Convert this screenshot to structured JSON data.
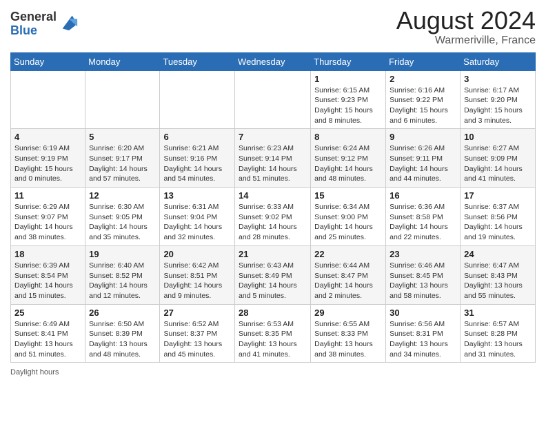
{
  "header": {
    "logo_general": "General",
    "logo_blue": "Blue",
    "month_title": "August 2024",
    "location": "Warmeriville, France"
  },
  "days_of_week": [
    "Sunday",
    "Monday",
    "Tuesday",
    "Wednesday",
    "Thursday",
    "Friday",
    "Saturday"
  ],
  "weeks": [
    [
      {
        "day": "",
        "info": ""
      },
      {
        "day": "",
        "info": ""
      },
      {
        "day": "",
        "info": ""
      },
      {
        "day": "",
        "info": ""
      },
      {
        "day": "1",
        "info": "Sunrise: 6:15 AM\nSunset: 9:23 PM\nDaylight: 15 hours\nand 8 minutes."
      },
      {
        "day": "2",
        "info": "Sunrise: 6:16 AM\nSunset: 9:22 PM\nDaylight: 15 hours\nand 6 minutes."
      },
      {
        "day": "3",
        "info": "Sunrise: 6:17 AM\nSunset: 9:20 PM\nDaylight: 15 hours\nand 3 minutes."
      }
    ],
    [
      {
        "day": "4",
        "info": "Sunrise: 6:19 AM\nSunset: 9:19 PM\nDaylight: 15 hours\nand 0 minutes."
      },
      {
        "day": "5",
        "info": "Sunrise: 6:20 AM\nSunset: 9:17 PM\nDaylight: 14 hours\nand 57 minutes."
      },
      {
        "day": "6",
        "info": "Sunrise: 6:21 AM\nSunset: 9:16 PM\nDaylight: 14 hours\nand 54 minutes."
      },
      {
        "day": "7",
        "info": "Sunrise: 6:23 AM\nSunset: 9:14 PM\nDaylight: 14 hours\nand 51 minutes."
      },
      {
        "day": "8",
        "info": "Sunrise: 6:24 AM\nSunset: 9:12 PM\nDaylight: 14 hours\nand 48 minutes."
      },
      {
        "day": "9",
        "info": "Sunrise: 6:26 AM\nSunset: 9:11 PM\nDaylight: 14 hours\nand 44 minutes."
      },
      {
        "day": "10",
        "info": "Sunrise: 6:27 AM\nSunset: 9:09 PM\nDaylight: 14 hours\nand 41 minutes."
      }
    ],
    [
      {
        "day": "11",
        "info": "Sunrise: 6:29 AM\nSunset: 9:07 PM\nDaylight: 14 hours\nand 38 minutes."
      },
      {
        "day": "12",
        "info": "Sunrise: 6:30 AM\nSunset: 9:05 PM\nDaylight: 14 hours\nand 35 minutes."
      },
      {
        "day": "13",
        "info": "Sunrise: 6:31 AM\nSunset: 9:04 PM\nDaylight: 14 hours\nand 32 minutes."
      },
      {
        "day": "14",
        "info": "Sunrise: 6:33 AM\nSunset: 9:02 PM\nDaylight: 14 hours\nand 28 minutes."
      },
      {
        "day": "15",
        "info": "Sunrise: 6:34 AM\nSunset: 9:00 PM\nDaylight: 14 hours\nand 25 minutes."
      },
      {
        "day": "16",
        "info": "Sunrise: 6:36 AM\nSunset: 8:58 PM\nDaylight: 14 hours\nand 22 minutes."
      },
      {
        "day": "17",
        "info": "Sunrise: 6:37 AM\nSunset: 8:56 PM\nDaylight: 14 hours\nand 19 minutes."
      }
    ],
    [
      {
        "day": "18",
        "info": "Sunrise: 6:39 AM\nSunset: 8:54 PM\nDaylight: 14 hours\nand 15 minutes."
      },
      {
        "day": "19",
        "info": "Sunrise: 6:40 AM\nSunset: 8:52 PM\nDaylight: 14 hours\nand 12 minutes."
      },
      {
        "day": "20",
        "info": "Sunrise: 6:42 AM\nSunset: 8:51 PM\nDaylight: 14 hours\nand 9 minutes."
      },
      {
        "day": "21",
        "info": "Sunrise: 6:43 AM\nSunset: 8:49 PM\nDaylight: 14 hours\nand 5 minutes."
      },
      {
        "day": "22",
        "info": "Sunrise: 6:44 AM\nSunset: 8:47 PM\nDaylight: 14 hours\nand 2 minutes."
      },
      {
        "day": "23",
        "info": "Sunrise: 6:46 AM\nSunset: 8:45 PM\nDaylight: 13 hours\nand 58 minutes."
      },
      {
        "day": "24",
        "info": "Sunrise: 6:47 AM\nSunset: 8:43 PM\nDaylight: 13 hours\nand 55 minutes."
      }
    ],
    [
      {
        "day": "25",
        "info": "Sunrise: 6:49 AM\nSunset: 8:41 PM\nDaylight: 13 hours\nand 51 minutes."
      },
      {
        "day": "26",
        "info": "Sunrise: 6:50 AM\nSunset: 8:39 PM\nDaylight: 13 hours\nand 48 minutes."
      },
      {
        "day": "27",
        "info": "Sunrise: 6:52 AM\nSunset: 8:37 PM\nDaylight: 13 hours\nand 45 minutes."
      },
      {
        "day": "28",
        "info": "Sunrise: 6:53 AM\nSunset: 8:35 PM\nDaylight: 13 hours\nand 41 minutes."
      },
      {
        "day": "29",
        "info": "Sunrise: 6:55 AM\nSunset: 8:33 PM\nDaylight: 13 hours\nand 38 minutes."
      },
      {
        "day": "30",
        "info": "Sunrise: 6:56 AM\nSunset: 8:31 PM\nDaylight: 13 hours\nand 34 minutes."
      },
      {
        "day": "31",
        "info": "Sunrise: 6:57 AM\nSunset: 8:28 PM\nDaylight: 13 hours\nand 31 minutes."
      }
    ]
  ],
  "footer": {
    "daylight_label": "Daylight hours"
  }
}
